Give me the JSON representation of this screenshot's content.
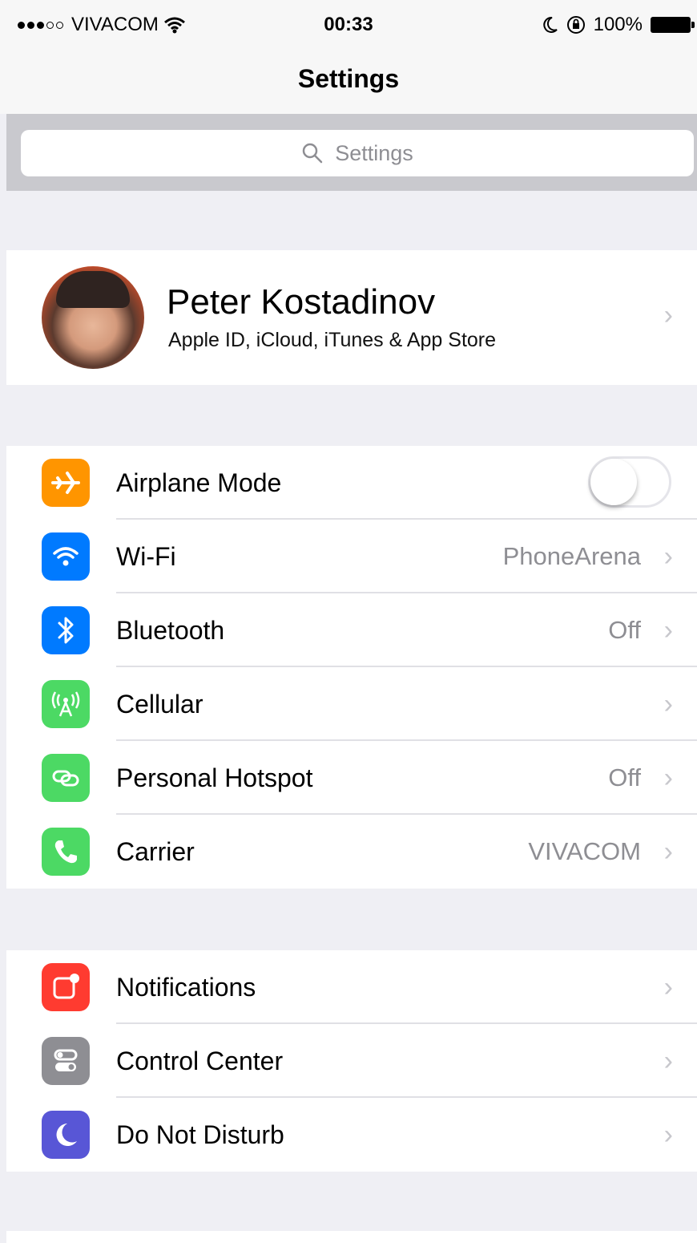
{
  "status_bar": {
    "carrier": "VIVACOM",
    "time": "00:33",
    "battery": "100%"
  },
  "nav": {
    "title": "Settings"
  },
  "search": {
    "placeholder": "Settings"
  },
  "profile": {
    "name": "Peter Kostadinov",
    "subtitle": "Apple ID, iCloud, iTunes & App Store"
  },
  "connectivity": [
    {
      "label": "Airplane Mode",
      "icon": "airplane-icon",
      "color": "#ff9500",
      "toggle_on": false
    },
    {
      "label": "Wi-Fi",
      "value": "PhoneArena",
      "icon": "wifi-icon",
      "color": "#007aff"
    },
    {
      "label": "Bluetooth",
      "value": "Off",
      "icon": "bluetooth-icon",
      "color": "#007aff"
    },
    {
      "label": "Cellular",
      "value": "",
      "icon": "cellular-icon",
      "color": "#4cd964"
    },
    {
      "label": "Personal Hotspot",
      "value": "Off",
      "icon": "hotspot-icon",
      "color": "#4cd964"
    },
    {
      "label": "Carrier",
      "value": "VIVACOM",
      "icon": "phone-icon",
      "color": "#4cd964"
    }
  ],
  "system": [
    {
      "label": "Notifications",
      "icon": "notifications-icon",
      "color": "#ff3b30"
    },
    {
      "label": "Control Center",
      "icon": "control-center-icon",
      "color": "#8e8e93"
    },
    {
      "label": "Do Not Disturb",
      "icon": "moon-icon",
      "color": "#5856d6"
    }
  ]
}
